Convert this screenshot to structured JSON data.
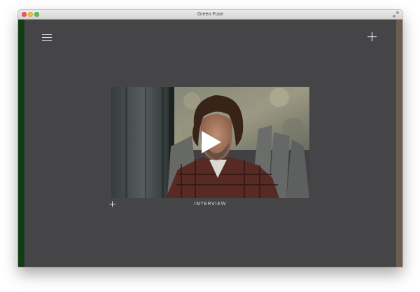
{
  "window": {
    "title": "Green Fuse"
  },
  "icons": {
    "menu": "hamburger-menu-icon",
    "add": "plus-icon",
    "play": "play-icon",
    "expand": "plus-icon",
    "fullscreen": "fullscreen-icon"
  },
  "video": {
    "caption": "INTERVIEW"
  },
  "colors": {
    "background": "#454446",
    "left_stripe": "#133b16",
    "right_stripe": "#6b5e50",
    "icon": "#e6e6e6"
  }
}
